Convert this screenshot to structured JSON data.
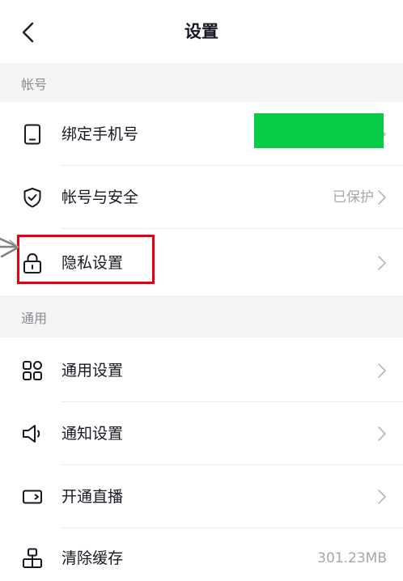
{
  "header": {
    "title": "设置",
    "back_icon": "chevron-left-icon"
  },
  "sections": [
    {
      "header": "帐号",
      "items": [
        {
          "label": "绑定手机号",
          "icon": "phone-icon",
          "value": "",
          "value_obscured": true
        },
        {
          "label": "帐号与安全",
          "icon": "shield-check-icon",
          "value": "已保护"
        },
        {
          "label": "隐私设置",
          "icon": "lock-icon",
          "value": "",
          "highlighted": true
        }
      ]
    },
    {
      "header": "通用",
      "items": [
        {
          "label": "通用设置",
          "icon": "grid-icon",
          "value": ""
        },
        {
          "label": "通知设置",
          "icon": "speaker-icon",
          "value": ""
        },
        {
          "label": "开通直播",
          "icon": "video-camera-icon",
          "value": ""
        },
        {
          "label": "清除缓存",
          "icon": "storage-icon",
          "value": "301.23MB"
        }
      ]
    }
  ],
  "colors": {
    "section_bg": "#f4f4f5",
    "obscure_block": "#08cc46",
    "highlight_border": "#e60012",
    "secondary_text": "#a6a7ab"
  }
}
